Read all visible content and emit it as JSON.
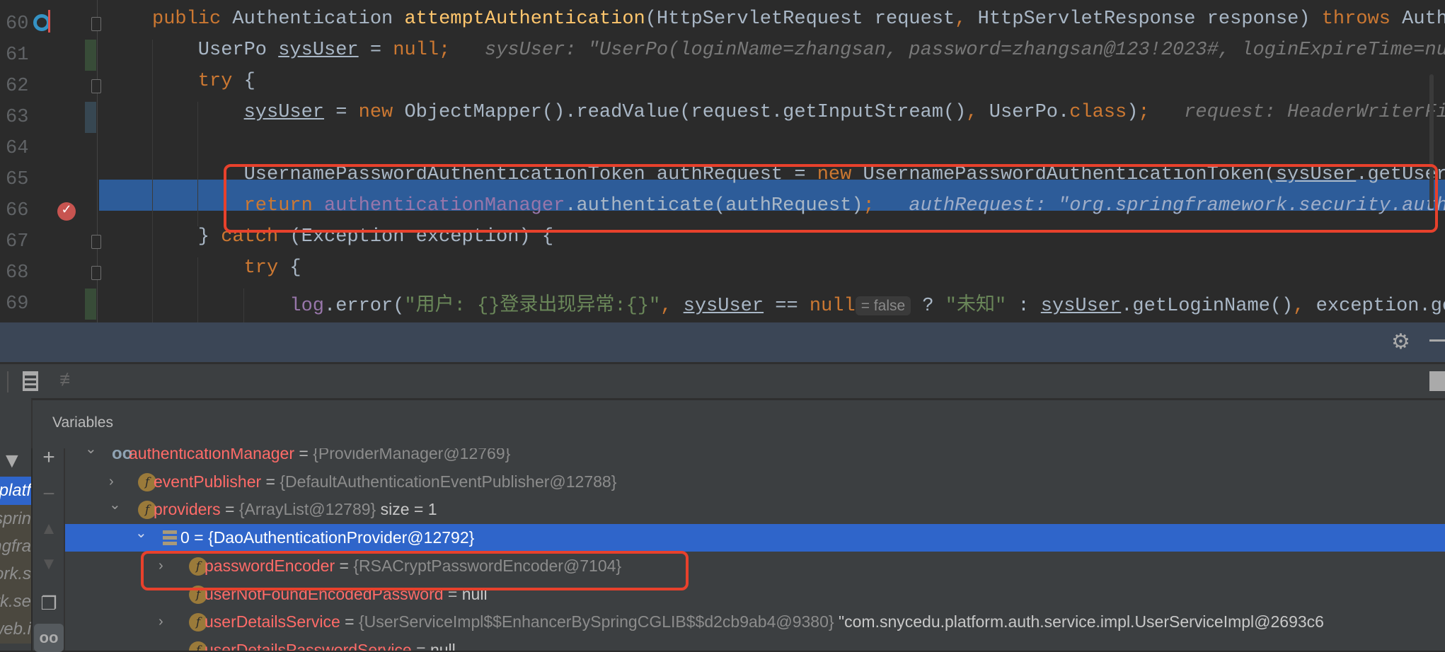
{
  "editor": {
    "current_line": 66,
    "lines": [
      {
        "num": "60",
        "indent": 0,
        "tokens": [
          [
            "public ",
            "kw"
          ],
          [
            "Authentication ",
            ""
          ],
          [
            "attemptAuthentication",
            "fn"
          ],
          [
            "(HttpServletRequest request",
            ""
          ],
          [
            ", ",
            "kw"
          ],
          [
            "HttpServletResponse response) ",
            ""
          ],
          [
            "throws ",
            "kw"
          ],
          [
            "AuthenticationException {",
            ""
          ]
        ]
      },
      {
        "num": "61",
        "indent": 1,
        "tokens": [
          [
            "UserPo ",
            ""
          ],
          [
            "sysUser",
            "u"
          ],
          [
            " = ",
            ""
          ],
          [
            "null;",
            "kw"
          ],
          [
            "   sysUser: \"UserPo(loginName=zhangsan, password=zhangsan@123!2023#, loginExpireTime=null",
            "hint"
          ]
        ]
      },
      {
        "num": "62",
        "indent": 1,
        "tokens": [
          [
            "try ",
            "kw"
          ],
          [
            "{",
            ""
          ]
        ]
      },
      {
        "num": "63",
        "indent": 2,
        "tokens": [
          [
            "sysUser",
            "u"
          ],
          [
            " = ",
            ""
          ],
          [
            "new ",
            "kw"
          ],
          [
            "ObjectMapper().readValue(request.getInputStream()",
            ""
          ],
          [
            ", ",
            "kw"
          ],
          [
            "UserPo.",
            ""
          ],
          [
            "class",
            "kw"
          ],
          [
            ")",
            ""
          ],
          [
            ";",
            "kw"
          ],
          [
            "   request: HeaderWriterFilter",
            "hint"
          ]
        ]
      },
      {
        "num": "64",
        "indent": 0,
        "tokens": []
      },
      {
        "num": "65",
        "indent": 2,
        "tokens": [
          [
            "UsernamePasswordAuthenticationToken authRequest = ",
            ""
          ],
          [
            "new ",
            "kw"
          ],
          [
            "UsernamePasswordAuthenticationToken(",
            ""
          ],
          [
            "sysUser",
            "u"
          ],
          [
            ".getUsername()",
            ""
          ]
        ]
      },
      {
        "num": "66",
        "indent": 2,
        "tokens": [
          [
            "return ",
            "kw"
          ],
          [
            "authenticationManager",
            "fld"
          ],
          [
            ".authenticate(authRequest)",
            ""
          ],
          [
            ";",
            "kw"
          ],
          [
            "   authRequest: \"org.springframework.security.authentication",
            "hint"
          ]
        ]
      },
      {
        "num": "67",
        "indent": 1,
        "tokens": [
          [
            "} ",
            ""
          ],
          [
            "catch ",
            "kw"
          ],
          [
            "(Exception exception) {",
            ""
          ]
        ]
      },
      {
        "num": "68",
        "indent": 2,
        "tokens": [
          [
            "try ",
            "kw"
          ],
          [
            "{",
            ""
          ]
        ]
      },
      {
        "num": "69",
        "indent": 3,
        "tokens": [
          [
            "log",
            "fld"
          ],
          [
            ".error(",
            ""
          ],
          [
            "\"用户: {}登录出现异常:{}\"",
            "str"
          ],
          [
            ", ",
            "kw"
          ],
          [
            "sysUser",
            "u"
          ],
          [
            " == ",
            ""
          ],
          [
            "null",
            "kw"
          ],
          [
            "= false",
            "inlay"
          ],
          [
            " ? ",
            ""
          ],
          [
            "\"未知\"",
            "str"
          ],
          [
            " : ",
            ""
          ],
          [
            "sysUser",
            "u"
          ],
          [
            ".getLoginName()",
            ""
          ],
          [
            ", ",
            "kw"
          ],
          [
            "exception.getMessage()",
            ""
          ]
        ]
      }
    ]
  },
  "debug_panel": {
    "variables_title": "Variables",
    "frames": [
      "platf",
      "sprin",
      "ngfra",
      "ork.s",
      "rk.se",
      "web.i"
    ],
    "selected_frame": 0,
    "tree": [
      {
        "level": 0,
        "expanded": true,
        "icon": "watch-glasses-icon",
        "name": "authenticationManager",
        "eq": " = ",
        "value": "{ProviderManager@12769}",
        "extra": ""
      },
      {
        "level": 1,
        "expanded": false,
        "icon": "field-icon",
        "name": "eventPublisher",
        "eq": " = ",
        "value": "{DefaultAuthenticationEventPublisher@12788}",
        "extra": ""
      },
      {
        "level": 1,
        "expanded": true,
        "icon": "field-icon",
        "name": "providers",
        "eq": " = ",
        "value": "{ArrayList@12789}",
        "extra": " size = 1"
      },
      {
        "level": 2,
        "expanded": true,
        "icon": "array-element-icon",
        "name": "0",
        "eq": " = ",
        "value": "{DaoAuthenticationProvider@12792}",
        "extra": "",
        "selected": true
      },
      {
        "level": 3,
        "expanded": false,
        "icon": "field-icon",
        "name": "passwordEncoder",
        "eq": " = ",
        "value": "{RSACryptPasswordEncoder@7104}",
        "extra": ""
      },
      {
        "level": 3,
        "expanded": null,
        "icon": "field-icon",
        "name": "userNotFoundEncodedPassword",
        "eq": " = ",
        "value": "",
        "extra": "null"
      },
      {
        "level": 3,
        "expanded": false,
        "icon": "field-icon",
        "name": "userDetailsService",
        "eq": " = ",
        "value": "{UserServiceImpl$$EnhancerBySpringCGLIB$$d2cb9ab4@9380}",
        "extra": " \"com.snycedu.platform.auth.service.impl.UserServiceImpl@2693c6"
      },
      {
        "level": 3,
        "expanded": null,
        "icon": "field-icon",
        "name": "userDetailsPasswordService",
        "eq": " = ",
        "value": "",
        "extra": "null"
      }
    ]
  },
  "colors": {
    "highlight_box": "#e8412c",
    "selection": "#2f65ca",
    "execution_line": "#2d5c99"
  }
}
